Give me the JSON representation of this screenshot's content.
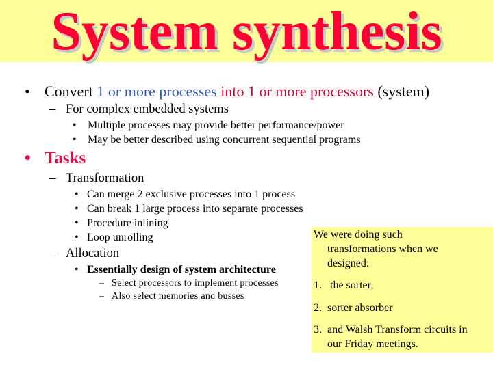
{
  "title": "System synthesis",
  "bullets": {
    "convert": {
      "prefix": "Convert ",
      "blue_part": "1 or more processes",
      "maroon_part": " into 1 or more processors",
      "suffix": " (system)"
    },
    "complex": "For complex embedded systems",
    "complex_sub": [
      "Multiple processes may provide better performance/power",
      "May be better described using concurrent sequential programs"
    ],
    "tasks": "Tasks",
    "transformation": "Transformation",
    "transformation_sub": [
      "Can merge 2 exclusive processes into 1 process",
      "Can break 1 large process into separate processes",
      "Procedure inlining",
      "Loop unrolling"
    ],
    "allocation": "Allocation",
    "allocation_sub": "Essentially design of system architecture",
    "allocation_sub_sub": [
      "Select processors to implement processes",
      "Also select memories and busses"
    ]
  },
  "markers": {
    "dot": "•",
    "dash": "–"
  },
  "note": {
    "intro_line1": "We were doing such",
    "intro_line2": "transformations when we",
    "intro_line3": "designed:",
    "items": [
      {
        "num": "1.",
        "text": " the sorter,"
      },
      {
        "num": "2.",
        "text": "sorter absorber"
      },
      {
        "num": "3.",
        "text": "and Walsh Transform circuits in",
        "text2": "our Friday meetings."
      }
    ]
  },
  "colors": {
    "title": "#ff0033",
    "band": "#ffff99",
    "blue": "#3355bb",
    "maroon": "#cc0033",
    "tasks": "#dd1144"
  }
}
